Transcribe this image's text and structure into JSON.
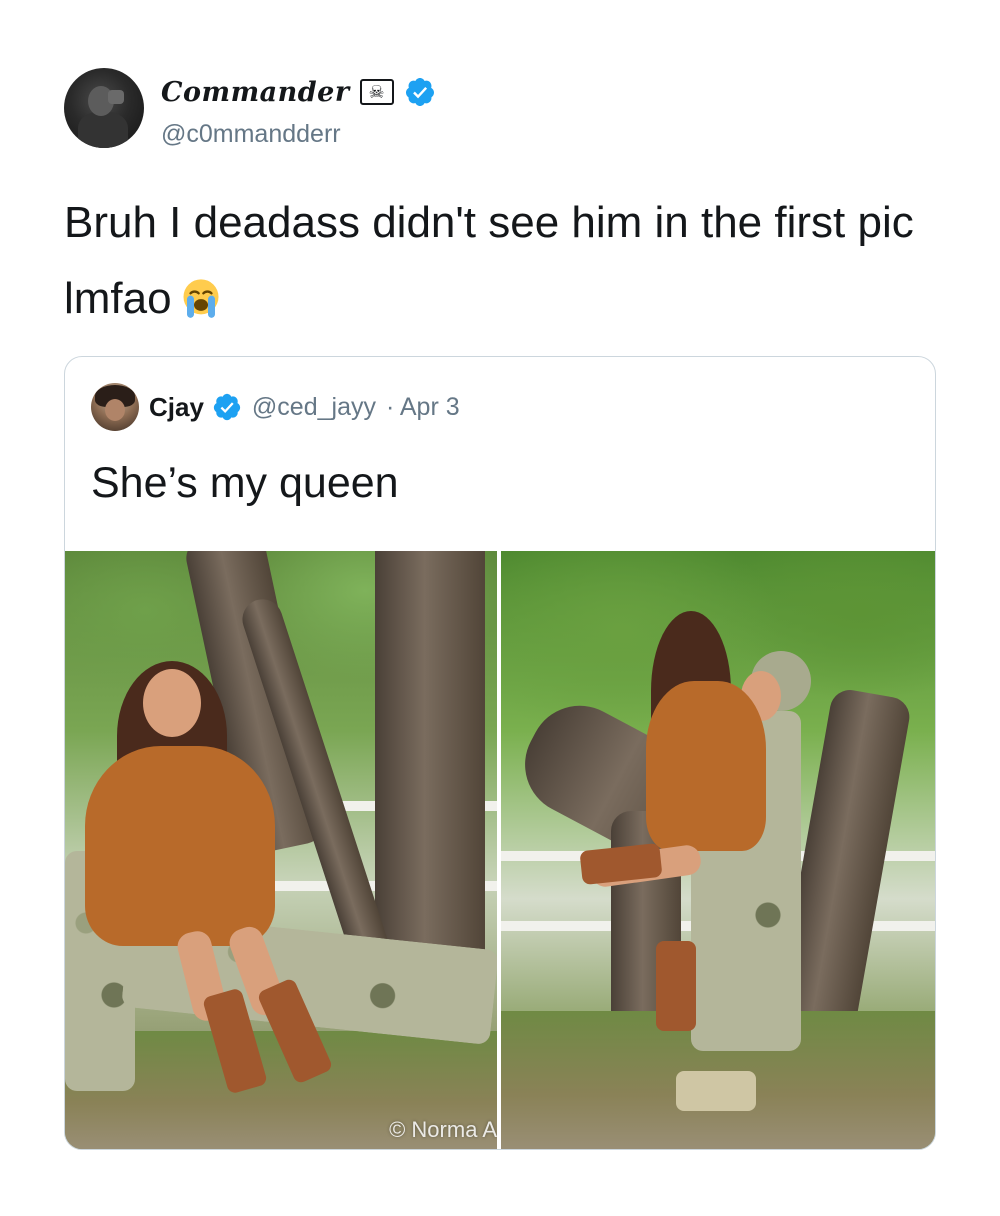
{
  "tweet": {
    "author": {
      "display_name": "Commander",
      "flag_icon": "skull-crossbones-flag-icon",
      "verified": true,
      "handle": "@c0mmandderr"
    },
    "text": "Bruh I deadass didn't see him in the first pic lmfao",
    "emoji": "loudly-crying-face-emoji"
  },
  "quoted_tweet": {
    "author": {
      "display_name": "Cjay",
      "verified": true,
      "handle": "@ced_jayy",
      "date": "· Apr 3"
    },
    "text": "She’s my queen",
    "media": {
      "watermark": "© Norma A"
    }
  },
  "colors": {
    "verified_blue": "#1da1f2",
    "text_primary": "#14171a",
    "text_secondary": "#657786",
    "border": "#ccd6dd"
  }
}
